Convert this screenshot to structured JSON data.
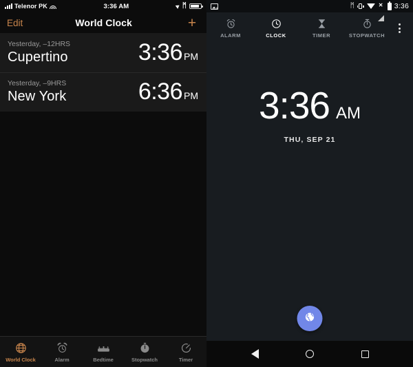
{
  "ios": {
    "status_bar": {
      "carrier": "Telenor PK",
      "time": "3:36 AM",
      "signal_icon": "cellular-signal-icon",
      "wifi_icon": "wifi-icon",
      "location_icon": "location-arrow-icon",
      "bluetooth_icon": "bluetooth-icon",
      "bluetooth_glyph": "ᛗ",
      "battery_icon": "battery-icon"
    },
    "nav_bar": {
      "edit_label": "Edit",
      "title": "World Clock",
      "add_label": "+",
      "accent_color": "#c8854c"
    },
    "clocks": [
      {
        "offset": "Yesterday, ‒12HRS",
        "city": "Cupertino",
        "time": "3:36",
        "meridiem": "PM"
      },
      {
        "offset": "Yesterday, ‒9HRS",
        "city": "New York",
        "time": "6:36",
        "meridiem": "PM"
      }
    ],
    "tabs": [
      {
        "label": "World Clock",
        "icon": "globe-icon",
        "active": true
      },
      {
        "label": "Alarm",
        "icon": "alarm-clock-icon",
        "active": false
      },
      {
        "label": "Bedtime",
        "icon": "bed-icon",
        "active": false
      },
      {
        "label": "Stopwatch",
        "icon": "stopwatch-icon",
        "active": false
      },
      {
        "label": "Timer",
        "icon": "timer-icon",
        "active": false
      }
    ]
  },
  "android": {
    "status_bar": {
      "image_icon": "image-notification-icon",
      "bluetooth_icon": "bluetooth-icon",
      "bluetooth_glyph": "ᛗ",
      "vibrate_icon": "vibrate-icon",
      "wifi_icon": "wifi-icon",
      "signal_icon": "cellular-signal-no-sim-icon",
      "battery_icon": "battery-icon",
      "time": "3:36"
    },
    "tabs": [
      {
        "label": "ALARM",
        "icon": "alarm-clock-icon",
        "active": false
      },
      {
        "label": "CLOCK",
        "icon": "clock-icon",
        "active": true
      },
      {
        "label": "TIMER",
        "icon": "hourglass-icon",
        "active": false
      },
      {
        "label": "STOPWATCH",
        "icon": "stopwatch-icon",
        "active": false
      }
    ],
    "overflow_menu": "more-options-icon",
    "clock": {
      "time": "3:36",
      "meridiem": "AM",
      "date": "THU, SEP 21"
    },
    "fab": {
      "icon": "globe-icon",
      "color": "#7187e8"
    },
    "nav_bar": {
      "back": "back-button",
      "home": "home-button",
      "recents": "recents-button"
    }
  }
}
